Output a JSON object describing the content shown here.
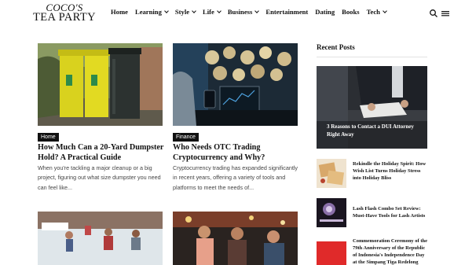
{
  "site": {
    "logo_top": "COCO'S",
    "logo_bottom": "TEA PARTY"
  },
  "nav": {
    "items": [
      {
        "label": "Home",
        "dropdown": false
      },
      {
        "label": "Learning",
        "dropdown": true
      },
      {
        "label": "Style",
        "dropdown": true
      },
      {
        "label": "Life",
        "dropdown": true
      },
      {
        "label": "Business",
        "dropdown": true
      },
      {
        "label": "Entertainment",
        "dropdown": false
      },
      {
        "label": "Dating",
        "dropdown": false
      },
      {
        "label": "Books",
        "dropdown": false
      },
      {
        "label": "Tech",
        "dropdown": true
      }
    ],
    "search_icon": "search-icon",
    "menu_icon": "hamburger-menu-icon"
  },
  "articles": [
    {
      "category": "Home",
      "title": "How Much Can a 20-Yard Dumpster Hold? A Practical Guide",
      "excerpt": "When you're tackling a major cleanup or a big project, figuring out what size dumpster you need can feel like..."
    },
    {
      "category": "Finance",
      "title": "Who Needs OTC Trading Cryptocurrency and Why?",
      "excerpt": "Cryptocurrency trading has expanded significantly in recent years, offering a variety of tools and platforms to meet the needs of..."
    }
  ],
  "sidebar": {
    "heading": "Recent Posts",
    "featured_title": "3 Reasons to Contact a DUI Attorney Right Away",
    "posts": [
      {
        "title": "Rekindle the Holiday Spirit: How Wish List Turns Holiday Stress into Holiday Bliss"
      },
      {
        "title": "Lash Flash Combo Set Review: Must-Have Tools for Lash Artists"
      },
      {
        "title": "Commemoration Ceremony of the 79th Anniversary of the Republic of Indonesia's Independence Day at the Simpang Tiga Redelong"
      }
    ]
  }
}
